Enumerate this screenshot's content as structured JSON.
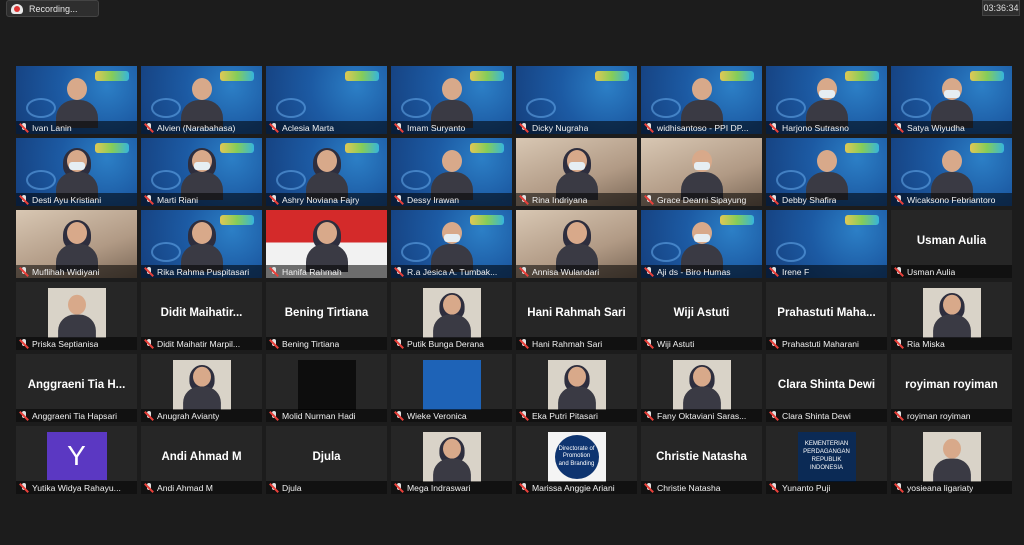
{
  "recording": {
    "label": "Recording..."
  },
  "clock": {
    "time": "03:36:34"
  },
  "participants": [
    {
      "name": "Ivan Lanin",
      "style": "blue",
      "mask": false,
      "hijab": false
    },
    {
      "name": "Alvien (Narabahasa)",
      "style": "blue",
      "active": true,
      "mask": false,
      "hijab": false
    },
    {
      "name": "Aclesia Marta",
      "style": "blue-empty"
    },
    {
      "name": "Imam Suryanto",
      "style": "blue",
      "mask": false,
      "hijab": false
    },
    {
      "name": "Dicky Nugraha",
      "style": "blue-empty"
    },
    {
      "name": "widhisantoso - PPI DP...",
      "style": "blue",
      "mask": false,
      "hijab": false
    },
    {
      "name": "Harjono Sutrasno",
      "style": "blue",
      "mask": true,
      "hijab": false
    },
    {
      "name": "Satya Wiyudha",
      "style": "blue",
      "mask": true,
      "hijab": false
    },
    {
      "name": "Desti Ayu Kristiani",
      "style": "blue",
      "mask": true,
      "hijab": true
    },
    {
      "name": "Marti Riani",
      "style": "blue",
      "mask": true,
      "hijab": true
    },
    {
      "name": "Ashry Noviana Fajry",
      "style": "blue",
      "mask": false,
      "hijab": true
    },
    {
      "name": "Dessy Irawan",
      "style": "blue",
      "mask": false,
      "hijab": false
    },
    {
      "name": "Rina Indriyana",
      "style": "room",
      "mask": true,
      "hijab": true
    },
    {
      "name": "Grace Dearni Sipayung",
      "style": "room",
      "mask": true,
      "hijab": false
    },
    {
      "name": "Debby Shafira",
      "style": "blue",
      "mask": false,
      "hijab": false
    },
    {
      "name": "Wicaksono Febriantoro",
      "style": "blue",
      "mask": false,
      "hijab": false
    },
    {
      "name": "Muflihah Widiyani",
      "style": "room",
      "mask": false,
      "hijab": true
    },
    {
      "name": "Rika Rahma Puspitasari",
      "style": "blue",
      "mask": false,
      "hijab": true
    },
    {
      "name": "Hanifa Rahmah",
      "style": "flag",
      "mask": false,
      "hijab": true
    },
    {
      "name": "R.a Jesica A. Tumbak...",
      "style": "blue",
      "mask": true,
      "hijab": false
    },
    {
      "name": "Annisa Wulandari",
      "style": "room",
      "mask": false,
      "hijab": true
    },
    {
      "name": "Aji ds - Biro Humas",
      "style": "blue",
      "mask": true,
      "hijab": false
    },
    {
      "name": "Irene F",
      "style": "blue-empty"
    },
    {
      "name": "Usman Aulia",
      "style": "text",
      "big": "Usman Aulia"
    },
    {
      "name": "Priska Septianisa",
      "style": "photo",
      "hijab": false
    },
    {
      "name": "Didit Maihatir Marpil...",
      "style": "text",
      "big": "Didit  Maihatir..."
    },
    {
      "name": "Bening Tirtiana",
      "style": "text",
      "big": "Bening Tirtiana"
    },
    {
      "name": "Putik Bunga Derana",
      "style": "photo",
      "hijab": true
    },
    {
      "name": "Hani Rahmah Sari",
      "style": "text",
      "big": "Hani Rahmah Sari"
    },
    {
      "name": "Wiji Astuti",
      "style": "text",
      "big": "Wiji Astuti"
    },
    {
      "name": "Prahastuti Maharani",
      "style": "text",
      "big": "Prahastuti  Maha..."
    },
    {
      "name": "Ria Miska",
      "style": "photo",
      "hijab": true
    },
    {
      "name": "Anggraeni Tia Hapsari",
      "style": "text",
      "big": "Anggraeni Tia H..."
    },
    {
      "name": "Anugrah Avianty",
      "style": "photo",
      "hijab": true
    },
    {
      "name": "Molid Nurman Hadi",
      "style": "photo-dark"
    },
    {
      "name": "Wieke Veronica",
      "style": "photo-blue"
    },
    {
      "name": "Eka Putri Pitasari",
      "style": "photo",
      "hijab": true
    },
    {
      "name": "Fany Oktaviani Saras...",
      "style": "photo",
      "hijab": true
    },
    {
      "name": "Clara Shinta Dewi",
      "style": "text",
      "big": "Clara Shinta Dewi"
    },
    {
      "name": "royiman royiman",
      "style": "text",
      "big": "royiman royiman"
    },
    {
      "name": "Yutika Widya Rahayu...",
      "style": "letter",
      "letter": "Y"
    },
    {
      "name": "Andi Ahmad M",
      "style": "text",
      "big": "Andi Ahmad M"
    },
    {
      "name": "Djula",
      "style": "text",
      "big": "Djula"
    },
    {
      "name": "Mega Indraswari",
      "style": "photo",
      "hijab": true
    },
    {
      "name": "Marissa Anggie Ariani",
      "style": "logo",
      "logo": "Directorate of Promotion and Branding"
    },
    {
      "name": "Christie Natasha",
      "style": "text",
      "big": "Christie Natasha"
    },
    {
      "name": "Yunanto Puji",
      "style": "navy",
      "logo": "KEMENTERIAN PERDAGANGAN REPUBLIK INDONESIA"
    },
    {
      "name": "yosieana ligariaty",
      "style": "photo",
      "hijab": false
    }
  ],
  "colors": {
    "background": "#1c1c1c",
    "active_border": "#d6e36a",
    "muted_mic": "#e8403a"
  }
}
